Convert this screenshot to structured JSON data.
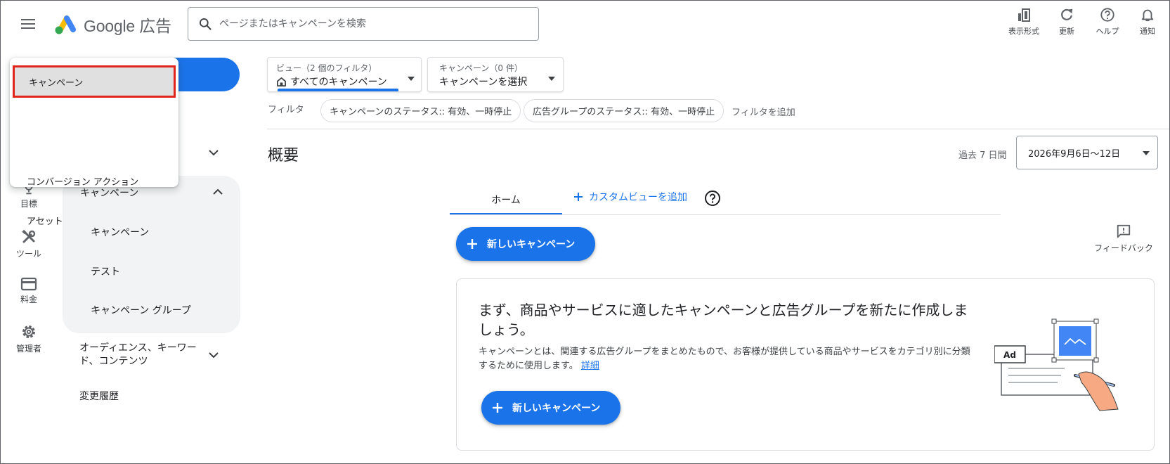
{
  "header": {
    "logo_text": "Google 広告",
    "search_placeholder": "ページまたはキャンペーンを検索",
    "actions": {
      "view_format": "表示形式",
      "refresh": "更新",
      "help": "ヘルプ",
      "notifications": "通知"
    }
  },
  "rail": {
    "goals": "目標",
    "tools": "ツール",
    "billing": "料金",
    "admin": "管理者"
  },
  "dropdown": {
    "items": [
      "キャンペーン",
      "コンバージョン アクション",
      "アセット"
    ]
  },
  "nav": {
    "campaign_group_title": "キャンペーン",
    "campaign_items": [
      "キャンペーン",
      "テスト",
      "キャンペーン グループ"
    ],
    "audience": "オーディエンス、キーワード、コンテンツ",
    "history": "変更履歴"
  },
  "filters": {
    "view_small": "ビュー（2 個のフィルタ）",
    "view_main": "すべてのキャンペーン",
    "campaign_small": "キャンペーン（0 件）",
    "campaign_main": "キャンペーンを選択",
    "label": "フィルタ",
    "chips": [
      "キャンペーンのステータス:: 有効、一時停止",
      "広告グループのステータス:: 有効、一時停止"
    ],
    "add": "フィルタを追加"
  },
  "overview": {
    "title": "概要",
    "range_label": "過去 7 日間",
    "date_range": "2026年9月6日～12日"
  },
  "tabs": {
    "home": "ホーム",
    "add_custom": "カスタムビューを追加"
  },
  "buttons": {
    "new_campaign": "新しいキャンペーン"
  },
  "feedback": "フィードバック",
  "card": {
    "title": "まず、商品やサービスに適したキャンペーンと広告グループを新たに作成しましょう。",
    "desc": "キャンペーンとは、関連する広告グループをまとめたもので、お客様が提供している商品やサービスをカテゴリ別に分類するために使用します。",
    "link": "詳細",
    "ad_label": "Ad"
  },
  "colors": {
    "accent": "#1a73e8",
    "highlight_border": "#e1251b",
    "google_yellow": "#fbbc04",
    "google_blue": "#4285f4",
    "google_green": "#34a853"
  }
}
